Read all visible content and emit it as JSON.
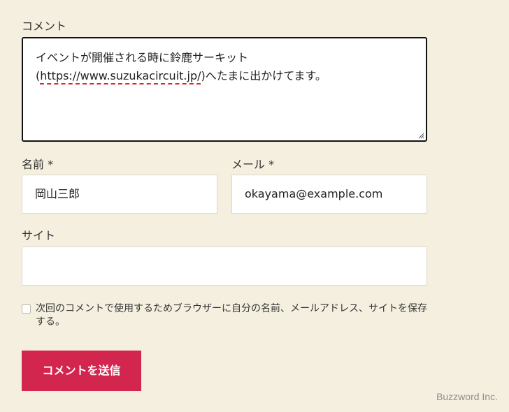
{
  "form": {
    "comment_label": "コメント",
    "comment_text_before": "イベントが開催される時に鈴鹿サーキット(",
    "comment_link": "https://www.suzukacircuit.jp/",
    "comment_text_after": ")へたまに出かけてます。",
    "name_label": "名前 *",
    "name_value": "岡山三郎",
    "email_label": "メール *",
    "email_value": "okayama@example.com",
    "site_label": "サイト",
    "site_value": "",
    "save_info_label": "次回のコメントで使用するためブラウザーに自分の名前、メールアドレス、サイトを保存する。",
    "submit_label": "コメントを送信"
  },
  "watermark": "Buzzword Inc.",
  "colors": {
    "background": "#f5efdf",
    "submit": "#d2264f",
    "spellcheck": "#e0242b"
  }
}
